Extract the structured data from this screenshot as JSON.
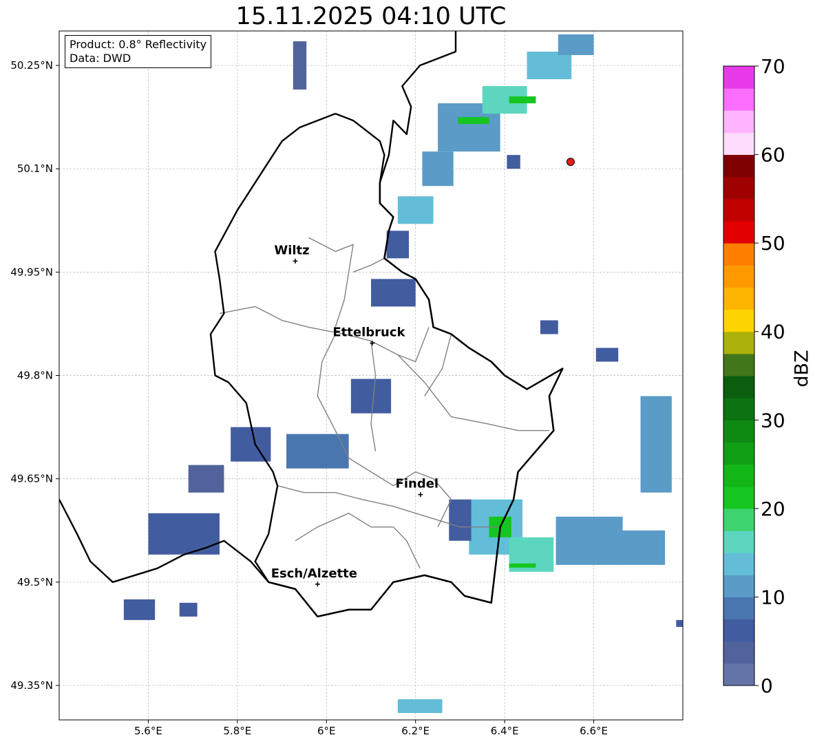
{
  "title": "15.11.2025 04:10 UTC",
  "info_box": {
    "product": "Product: 0.8° Reflectivity",
    "source": "Data: DWD"
  },
  "map": {
    "lon_range": [
      5.4,
      6.8
    ],
    "lat_range": [
      49.3,
      50.3
    ],
    "lon_ticks": [
      {
        "value": 5.6,
        "label": "5.6°E"
      },
      {
        "value": 5.8,
        "label": "5.8°E"
      },
      {
        "value": 6.0,
        "label": "6°E"
      },
      {
        "value": 6.2,
        "label": "6.2°E"
      },
      {
        "value": 6.4,
        "label": "6.4°E"
      },
      {
        "value": 6.6,
        "label": "6.6°E"
      }
    ],
    "lat_ticks": [
      {
        "value": 50.25,
        "label": "50.25°N"
      },
      {
        "value": 50.1,
        "label": "50.1°N"
      },
      {
        "value": 49.95,
        "label": "49.95°N"
      },
      {
        "value": 49.8,
        "label": "49.8°N"
      },
      {
        "value": 49.65,
        "label": "49.65°N"
      },
      {
        "value": 49.5,
        "label": "49.5°N"
      },
      {
        "value": 49.35,
        "label": "49.35°N"
      }
    ],
    "grid": true,
    "cities": [
      {
        "name": "Wiltz",
        "lon": 5.93,
        "lat": 49.966
      },
      {
        "name": "Ettelbruck",
        "lon": 6.103,
        "lat": 49.847
      },
      {
        "name": "Findel",
        "lon": 6.211,
        "lat": 49.627
      },
      {
        "name": "Esch/Alzette",
        "lon": 5.98,
        "lat": 49.497
      }
    ],
    "radar_site": {
      "lon": 6.548,
      "lat": 50.11,
      "color": "#e31a1c"
    },
    "country_border": [
      [
        6.29,
        50.3
      ],
      [
        6.29,
        50.27
      ],
      [
        6.21,
        50.25
      ],
      [
        6.17,
        50.22
      ],
      [
        6.19,
        50.19
      ],
      [
        6.18,
        50.15
      ],
      [
        6.15,
        50.17
      ],
      [
        6.14,
        50.12
      ],
      [
        6.12,
        50.08
      ],
      [
        6.12,
        50.05
      ],
      [
        6.15,
        50.03
      ],
      [
        6.14,
        50.01
      ],
      [
        6.13,
        49.97
      ],
      [
        6.17,
        49.95
      ],
      [
        6.2,
        49.94
      ],
      [
        6.23,
        49.91
      ],
      [
        6.24,
        49.87
      ],
      [
        6.28,
        49.86
      ],
      [
        6.32,
        49.84
      ],
      [
        6.37,
        49.82
      ],
      [
        6.4,
        49.8
      ],
      [
        6.45,
        49.78
      ],
      [
        6.53,
        49.81
      ],
      [
        6.5,
        49.77
      ],
      [
        6.51,
        49.72
      ],
      [
        6.43,
        49.66
      ],
      [
        6.42,
        49.62
      ],
      [
        6.39,
        49.58
      ],
      [
        6.37,
        49.47
      ],
      [
        6.31,
        49.48
      ],
      [
        6.28,
        49.5
      ],
      [
        6.22,
        49.51
      ],
      [
        6.15,
        49.5
      ],
      [
        6.1,
        49.46
      ],
      [
        6.05,
        49.46
      ],
      [
        5.98,
        49.45
      ],
      [
        5.93,
        49.49
      ],
      [
        5.87,
        49.5
      ],
      [
        5.83,
        49.53
      ],
      [
        5.77,
        49.56
      ],
      [
        5.73,
        49.55
      ],
      [
        5.68,
        49.54
      ],
      [
        5.62,
        49.52
      ],
      [
        5.57,
        49.51
      ],
      [
        5.52,
        49.5
      ],
      [
        5.47,
        49.53
      ],
      [
        5.44,
        49.57
      ],
      [
        5.4,
        49.62
      ]
    ],
    "lux_border": [
      [
        6.02,
        50.18
      ],
      [
        6.06,
        50.17
      ],
      [
        6.08,
        50.16
      ],
      [
        6.12,
        50.14
      ],
      [
        6.13,
        50.12
      ],
      [
        6.12,
        50.08
      ],
      [
        6.12,
        50.05
      ],
      [
        6.15,
        50.03
      ],
      [
        6.14,
        50.01
      ],
      [
        6.13,
        49.97
      ],
      [
        6.17,
        49.95
      ],
      [
        6.2,
        49.94
      ],
      [
        6.23,
        49.91
      ],
      [
        6.24,
        49.87
      ],
      [
        6.28,
        49.86
      ],
      [
        6.32,
        49.84
      ],
      [
        6.37,
        49.82
      ],
      [
        6.4,
        49.8
      ],
      [
        6.45,
        49.78
      ],
      [
        6.53,
        49.81
      ],
      [
        6.5,
        49.77
      ],
      [
        6.51,
        49.72
      ],
      [
        6.43,
        49.66
      ],
      [
        6.42,
        49.62
      ],
      [
        6.39,
        49.58
      ],
      [
        6.37,
        49.47
      ],
      [
        6.31,
        49.48
      ],
      [
        6.28,
        49.5
      ],
      [
        6.22,
        49.51
      ],
      [
        6.15,
        49.5
      ],
      [
        6.1,
        49.46
      ],
      [
        6.05,
        49.46
      ],
      [
        5.98,
        49.45
      ],
      [
        5.93,
        49.49
      ],
      [
        5.87,
        49.5
      ],
      [
        5.84,
        49.53
      ],
      [
        5.87,
        49.57
      ],
      [
        5.89,
        49.64
      ],
      [
        5.88,
        49.66
      ],
      [
        5.84,
        49.7
      ],
      [
        5.82,
        49.76
      ],
      [
        5.78,
        49.79
      ],
      [
        5.75,
        49.8
      ],
      [
        5.74,
        49.86
      ],
      [
        5.77,
        49.89
      ],
      [
        5.76,
        49.94
      ],
      [
        5.75,
        49.98
      ],
      [
        5.8,
        50.04
      ],
      [
        5.86,
        50.1
      ],
      [
        5.9,
        50.14
      ],
      [
        5.94,
        50.16
      ],
      [
        6.02,
        50.18
      ]
    ],
    "canton_borders": [
      [
        [
          5.76,
          49.89
        ],
        [
          5.84,
          49.9
        ],
        [
          5.9,
          49.88
        ],
        [
          5.96,
          49.87
        ],
        [
          6.04,
          49.86
        ],
        [
          6.1,
          49.85
        ],
        [
          6.16,
          49.83
        ],
        [
          6.2,
          49.82
        ],
        [
          6.23,
          49.87
        ]
      ],
      [
        [
          5.96,
          50.0
        ],
        [
          6.02,
          49.98
        ],
        [
          6.06,
          49.99
        ],
        [
          6.05,
          49.95
        ],
        [
          6.04,
          49.91
        ],
        [
          6.02,
          49.87
        ]
      ],
      [
        [
          6.13,
          49.97
        ],
        [
          6.1,
          49.96
        ],
        [
          6.06,
          49.95
        ]
      ],
      [
        [
          6.02,
          49.86
        ],
        [
          5.99,
          49.82
        ],
        [
          5.98,
          49.77
        ],
        [
          6.02,
          49.72
        ],
        [
          6.05,
          49.68
        ],
        [
          6.1,
          49.66
        ],
        [
          6.15,
          49.64
        ],
        [
          6.2,
          49.66
        ],
        [
          6.24,
          49.65
        ],
        [
          6.28,
          49.62
        ]
      ],
      [
        [
          6.1,
          49.85
        ],
        [
          6.11,
          49.8
        ],
        [
          6.1,
          49.73
        ],
        [
          6.11,
          49.69
        ]
      ],
      [
        [
          6.16,
          49.83
        ],
        [
          6.22,
          49.79
        ],
        [
          6.28,
          49.74
        ],
        [
          6.36,
          49.73
        ],
        [
          6.43,
          49.72
        ],
        [
          6.5,
          49.72
        ]
      ],
      [
        [
          6.28,
          49.86
        ],
        [
          6.26,
          49.81
        ],
        [
          6.22,
          49.77
        ]
      ],
      [
        [
          5.89,
          49.64
        ],
        [
          5.95,
          49.63
        ],
        [
          6.02,
          49.63
        ],
        [
          6.08,
          49.62
        ],
        [
          6.15,
          49.61
        ],
        [
          6.2,
          49.6
        ],
        [
          6.25,
          49.59
        ],
        [
          6.3,
          49.58
        ],
        [
          6.39,
          49.58
        ]
      ],
      [
        [
          5.93,
          49.56
        ],
        [
          5.98,
          49.58
        ],
        [
          6.05,
          49.6
        ],
        [
          6.1,
          49.58
        ],
        [
          6.15,
          49.58
        ],
        [
          6.18,
          49.56
        ],
        [
          6.21,
          49.52
        ]
      ],
      [
        [
          6.28,
          49.62
        ],
        [
          6.25,
          49.58
        ]
      ]
    ],
    "reflectivity_cells": [
      {
        "lon": 6.32,
        "lat": 50.16,
        "w": 0.14,
        "h": 0.07,
        "dbz": 12
      },
      {
        "lon": 6.4,
        "lat": 50.2,
        "w": 0.1,
        "h": 0.04,
        "dbz": 16
      },
      {
        "lon": 6.5,
        "lat": 50.25,
        "w": 0.1,
        "h": 0.04,
        "dbz": 14
      },
      {
        "lon": 6.56,
        "lat": 50.28,
        "w": 0.08,
        "h": 0.03,
        "dbz": 10
      },
      {
        "lon": 6.25,
        "lat": 50.1,
        "w": 0.07,
        "h": 0.05,
        "dbz": 10
      },
      {
        "lon": 6.2,
        "lat": 50.04,
        "w": 0.08,
        "h": 0.04,
        "dbz": 13
      },
      {
        "lon": 6.16,
        "lat": 49.99,
        "w": 0.05,
        "h": 0.04,
        "dbz": 7
      },
      {
        "lon": 6.44,
        "lat": 50.2,
        "w": 0.06,
        "h": 0.01,
        "dbz": 22
      },
      {
        "lon": 6.33,
        "lat": 50.17,
        "w": 0.07,
        "h": 0.01,
        "dbz": 21
      },
      {
        "lon": 5.94,
        "lat": 50.25,
        "w": 0.03,
        "h": 0.07,
        "dbz": 4
      },
      {
        "lon": 6.63,
        "lat": 49.83,
        "w": 0.05,
        "h": 0.02,
        "dbz": 6
      },
      {
        "lon": 6.5,
        "lat": 49.87,
        "w": 0.04,
        "h": 0.02,
        "dbz": 7
      },
      {
        "lon": 6.42,
        "lat": 50.11,
        "w": 0.03,
        "h": 0.02,
        "dbz": 5
      },
      {
        "lon": 6.15,
        "lat": 49.92,
        "w": 0.1,
        "h": 0.04,
        "dbz": 5
      },
      {
        "lon": 6.1,
        "lat": 49.77,
        "w": 0.09,
        "h": 0.05,
        "dbz": 5
      },
      {
        "lon": 5.98,
        "lat": 49.69,
        "w": 0.14,
        "h": 0.05,
        "dbz": 9
      },
      {
        "lon": 5.83,
        "lat": 49.7,
        "w": 0.09,
        "h": 0.05,
        "dbz": 6
      },
      {
        "lon": 5.68,
        "lat": 49.57,
        "w": 0.16,
        "h": 0.06,
        "dbz": 6
      },
      {
        "lon": 5.73,
        "lat": 49.65,
        "w": 0.08,
        "h": 0.04,
        "dbz": 4
      },
      {
        "lon": 5.58,
        "lat": 49.46,
        "w": 0.07,
        "h": 0.03,
        "dbz": 5
      },
      {
        "lon": 5.69,
        "lat": 49.46,
        "w": 0.04,
        "h": 0.02,
        "dbz": 5
      },
      {
        "lon": 6.74,
        "lat": 49.7,
        "w": 0.07,
        "h": 0.14,
        "dbz": 12
      },
      {
        "lon": 6.38,
        "lat": 49.58,
        "w": 0.12,
        "h": 0.08,
        "dbz": 13
      },
      {
        "lon": 6.46,
        "lat": 49.54,
        "w": 0.1,
        "h": 0.05,
        "dbz": 17
      },
      {
        "lon": 6.59,
        "lat": 49.56,
        "w": 0.15,
        "h": 0.07,
        "dbz": 11
      },
      {
        "lon": 6.71,
        "lat": 49.55,
        "w": 0.1,
        "h": 0.05,
        "dbz": 12
      },
      {
        "lon": 6.39,
        "lat": 49.58,
        "w": 0.05,
        "h": 0.03,
        "dbz": 20
      },
      {
        "lon": 6.44,
        "lat": 49.524,
        "w": 0.06,
        "h": 0.006,
        "dbz": 22
      },
      {
        "lon": 6.3,
        "lat": 49.59,
        "w": 0.05,
        "h": 0.06,
        "dbz": 5
      },
      {
        "lon": 6.21,
        "lat": 49.32,
        "w": 0.1,
        "h": 0.02,
        "dbz": 13
      },
      {
        "lon": 6.795,
        "lat": 49.44,
        "w": 0.02,
        "h": 0.01,
        "dbz": 5
      }
    ]
  },
  "colorbar": {
    "label": "dBZ",
    "min": 0,
    "max": 70,
    "ticks": [
      {
        "value": 0,
        "label": "0"
      },
      {
        "value": 10,
        "label": "10"
      },
      {
        "value": 20,
        "label": "20"
      },
      {
        "value": 30,
        "label": "30"
      },
      {
        "value": 40,
        "label": "40"
      },
      {
        "value": 50,
        "label": "50"
      },
      {
        "value": 60,
        "label": "60"
      },
      {
        "value": 70,
        "label": "70"
      }
    ],
    "colors": [
      "#6574a8",
      "#52639c",
      "#425ca0",
      "#4a76b0",
      "#5a9bc8",
      "#63bdd8",
      "#5cd6bf",
      "#3dd36f",
      "#14c61f",
      "#12b617",
      "#109e14",
      "#0e8a12",
      "#0c7311",
      "#0a5e0e",
      "#42761a",
      "#adb20a",
      "#fed400",
      "#fdb400",
      "#fe9a00",
      "#fe7f00",
      "#e20000",
      "#c10000",
      "#9f0000",
      "#7e0000",
      "#fedcfe",
      "#feb4fe",
      "#fe6efe",
      "#e93ae9"
    ]
  }
}
